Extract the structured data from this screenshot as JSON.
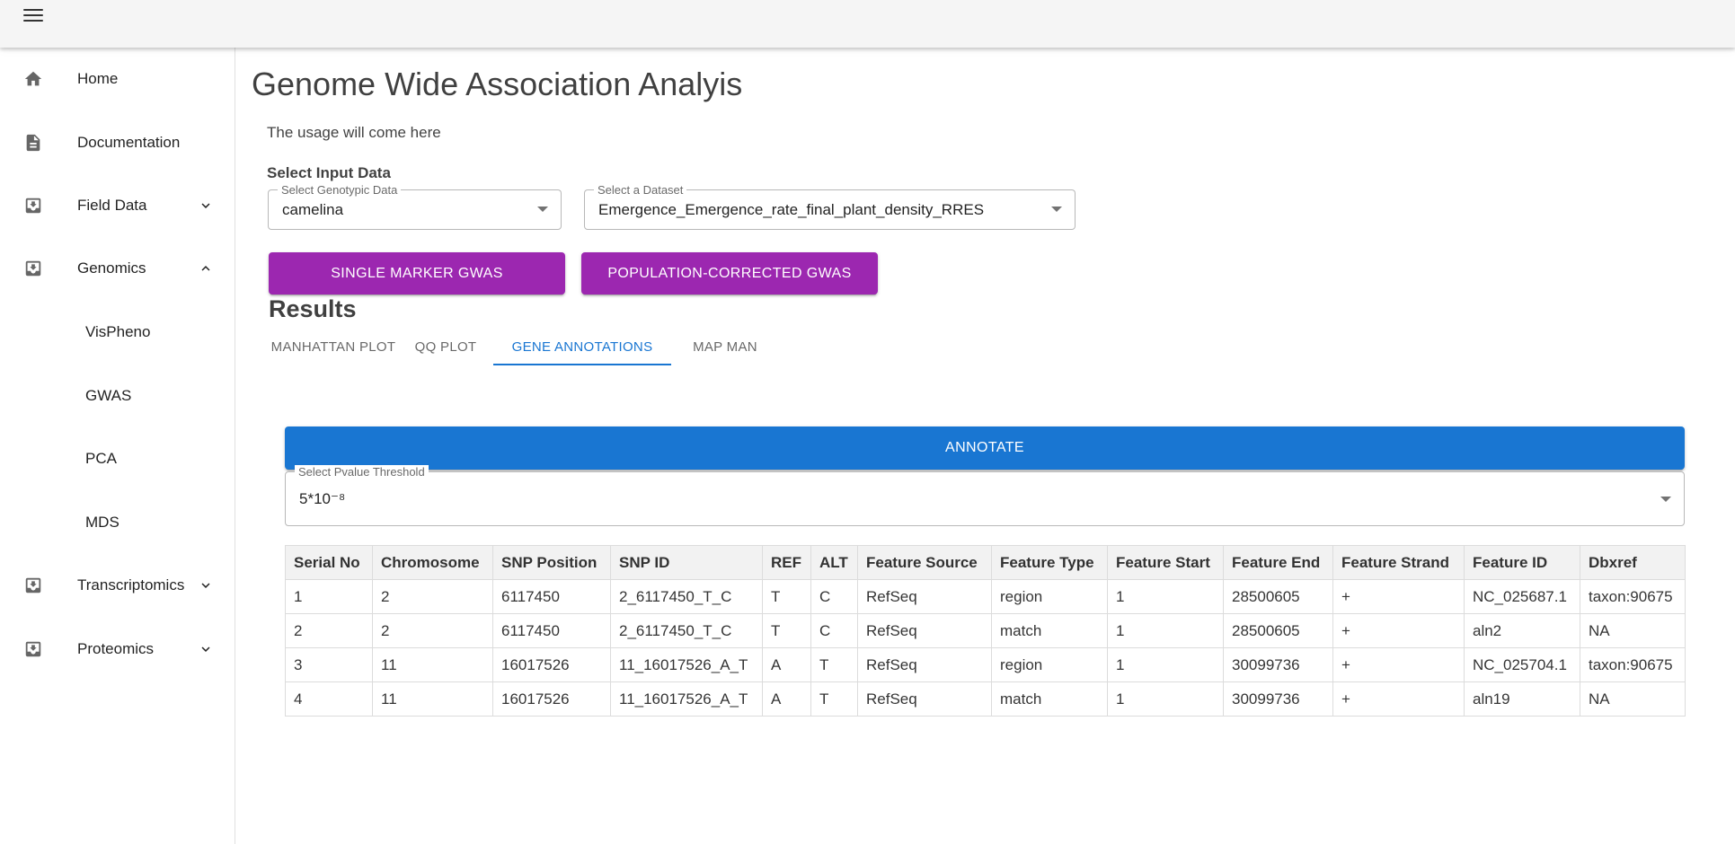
{
  "sidebar": {
    "items": [
      {
        "label": "Home",
        "icon": "home-icon"
      },
      {
        "label": "Documentation",
        "icon": "document-icon"
      },
      {
        "label": "Field Data",
        "icon": "inbox-download-icon",
        "expanded": false
      },
      {
        "label": "Genomics",
        "icon": "inbox-download-icon",
        "expanded": true
      },
      {
        "label": "VisPheno"
      },
      {
        "label": "GWAS"
      },
      {
        "label": "PCA"
      },
      {
        "label": "MDS"
      },
      {
        "label": "Transcriptomics",
        "icon": "inbox-download-icon",
        "expanded": false
      },
      {
        "label": "Proteomics",
        "icon": "inbox-download-icon",
        "expanded": false
      }
    ]
  },
  "main": {
    "title": "Genome Wide Association Analyis",
    "usage": "The usage will come here",
    "input_section_label": "Select Input Data",
    "genotypic_select": {
      "legend": "Select Genotypic Data",
      "value": "camelina"
    },
    "dataset_select": {
      "legend": "Select a Dataset",
      "value": "Emergence_Emergence_rate_final_plant_density_RRES"
    },
    "buttons": {
      "single_marker": "Single Marker GWAS",
      "population_corrected": "Population-Corrected GWAS"
    },
    "results_title": "Results",
    "tabs": [
      {
        "label": "Manhattan Plot",
        "active": false
      },
      {
        "label": "QQ Plot",
        "active": false
      },
      {
        "label": "Gene Annotations",
        "active": true
      },
      {
        "label": "Map Man",
        "active": false
      }
    ],
    "annotate_button": "Annotate",
    "pvalue_select": {
      "legend": "Select Pvalue Threshold",
      "value": "5*10⁻⁸"
    }
  },
  "table": {
    "headers": [
      "Serial No",
      "Chromosome",
      "SNP Position",
      "SNP ID",
      "REF",
      "ALT",
      "Feature Source",
      "Feature Type",
      "Feature Start",
      "Feature End",
      "Feature Strand",
      "Feature ID",
      "Dbxref"
    ],
    "rows": [
      [
        "1",
        "2",
        "6117450",
        "2_6117450_T_C",
        "T",
        "C",
        "RefSeq",
        "region",
        "1",
        "28500605",
        "+",
        "NC_025687.1",
        "taxon:90675"
      ],
      [
        "2",
        "2",
        "6117450",
        "2_6117450_T_C",
        "T",
        "C",
        "RefSeq",
        "match",
        "1",
        "28500605",
        "+",
        "aln2",
        "NA"
      ],
      [
        "3",
        "11",
        "16017526",
        "11_16017526_A_T",
        "A",
        "T",
        "RefSeq",
        "region",
        "1",
        "30099736",
        "+",
        "NC_025704.1",
        "taxon:90675"
      ],
      [
        "4",
        "11",
        "16017526",
        "11_16017526_A_T",
        "A",
        "T",
        "RefSeq",
        "match",
        "1",
        "30099736",
        "+",
        "aln19",
        "NA"
      ]
    ]
  },
  "colors": {
    "primary": "#1976d2",
    "secondary": "#9c27b0",
    "appbar": "#f5f5f5"
  }
}
